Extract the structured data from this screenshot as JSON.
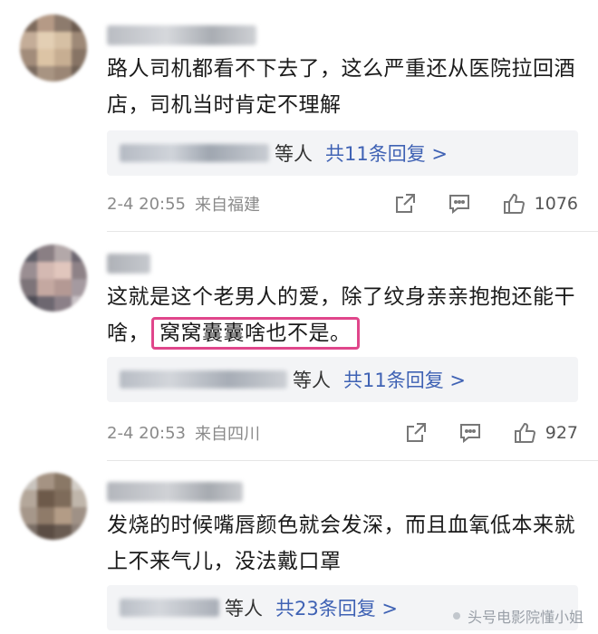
{
  "comments": [
    {
      "text": "路人司机都看不下去了，这么严重还从医院拉回酒店，司机当时肯定不理解",
      "reply_suffix": "等人",
      "reply_link": "共11条回复 >",
      "date": "2-4 20:55",
      "location": "来自福建",
      "likes": "1076"
    },
    {
      "text_before": "这就是这个老男人的爱，除了纹身亲亲抱抱还能干啥，",
      "text_highlight": "窝窝囊囊啥也不是。",
      "reply_suffix": "等人",
      "reply_link": "共11条回复 >",
      "date": "2-4 20:53",
      "location": "来自四川",
      "likes": "927"
    },
    {
      "text": "发烧的时候嘴唇颜色就会发深，而且血氧低本来就上不来气儿，没法戴口罩",
      "reply_suffix": "等人",
      "reply_link": "共23条回复 >"
    }
  ],
  "watermark": "头号电影院懂小姐",
  "colors": {
    "highlight_border": "#e0468b",
    "reply_link": "#3f62b4",
    "meta_text": "#8a8a8a"
  },
  "icons": [
    "share-icon",
    "comment-icon",
    "like-icon"
  ]
}
